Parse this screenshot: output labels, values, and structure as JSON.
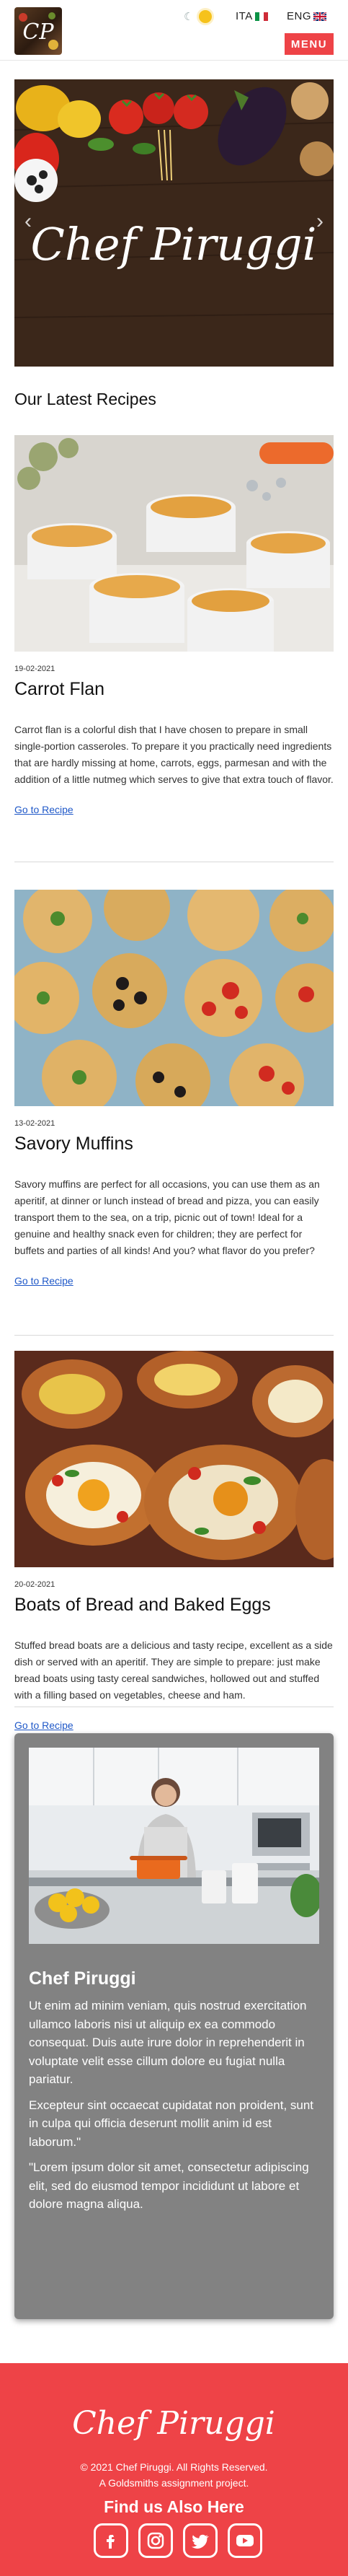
{
  "header": {
    "logo_text": "CP",
    "lang_it": "ITA",
    "lang_en": "ENG",
    "menu_label": "MENU"
  },
  "hero": {
    "script_title": "Chef Piruggi"
  },
  "recipes_title": "Our Latest Recipes",
  "recipes": [
    {
      "date": "19-02-2021",
      "title": "Carrot Flan",
      "description": "Carrot flan is a colorful dish that I have chosen to prepare in small single-portion casseroles. To prepare it you practically need ingredients that are hardly missing at home, carrots, eggs, parmesan and with the addition of a little nutmeg which serves to give that extra touch of flavor.",
      "link": "Go to Recipe"
    },
    {
      "date": "13-02-2021",
      "title": "Savory Muffins",
      "description": "Savory muffins are perfect for all occasions, you can use them as an aperitif, at dinner or lunch instead of bread and pizza, you can easily transport them to the sea, on a trip, picnic out of town! Ideal for a genuine and healthy snack even for children; they are perfect for buffets and parties of all kinds! And you? what flavor do you prefer?",
      "link": "Go to Recipe"
    },
    {
      "date": "20-02-2021",
      "title": "Boats of Bread and Baked Eggs",
      "description": "Stuffed bread boats are a delicious and tasty recipe, excellent as a side dish or served with an aperitif. They are simple to prepare: just make bread boats using tasty cereal sandwiches, hollowed out and stuffed with a filling based on vegetables, cheese and ham.",
      "link": "Go to Recipe"
    }
  ],
  "chef": {
    "name": "Chef Piruggi",
    "para1": "Ut enim ad minim veniam, quis nostrud exercitation ullamco laboris nisi ut aliquip ex ea commodo consequat. Duis aute irure dolor in reprehenderit in voluptate velit esse cillum dolore eu fugiat nulla pariatur.",
    "para2": "Excepteur sint occaecat cupidatat non proident, sunt in culpa qui officia deserunt mollit anim id est laborum.\"",
    "para3": "\"Lorem ipsum dolor sit amet, consectetur adipiscing elit, sed do eiusmod tempor incididunt ut labore et dolore magna aliqua."
  },
  "footer": {
    "brand": "Chef Piruggi",
    "copyright": "© 2021 Chef Piruggi. All Rights Reserved.",
    "project": "A Goldsmiths assignment project.",
    "find_us": "Find us Also Here"
  },
  "colors": {
    "accent": "#ee4347",
    "card": "#828282",
    "link": "#1f58c8"
  }
}
